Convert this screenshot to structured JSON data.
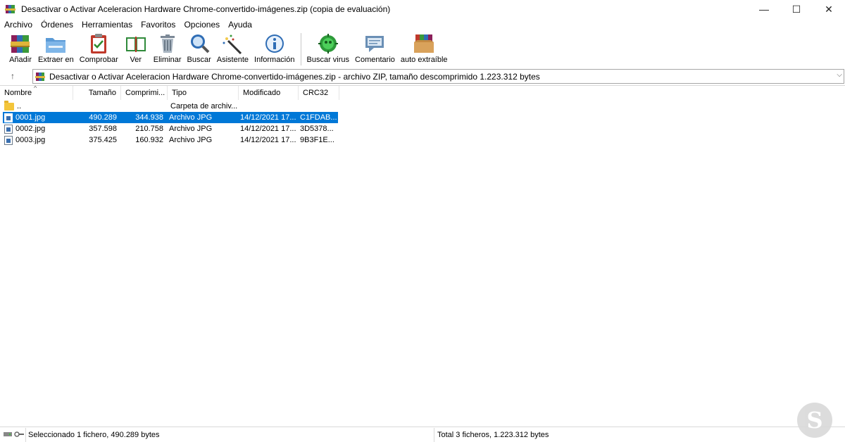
{
  "window": {
    "title": "Desactivar o Activar Aceleracion Hardware Chrome-convertido-imágenes.zip (copia de evaluación)",
    "minimize": "—",
    "maximize": "☐",
    "close": "✕"
  },
  "menu": [
    "Archivo",
    "Órdenes",
    "Herramientas",
    "Favoritos",
    "Opciones",
    "Ayuda"
  ],
  "toolbar": [
    {
      "label": "Añadir",
      "icon": "add-books-icon"
    },
    {
      "label": "Extraer en",
      "icon": "extract-folder-icon"
    },
    {
      "label": "Comprobar",
      "icon": "test-clipboard-icon"
    },
    {
      "label": "Ver",
      "icon": "view-book-icon"
    },
    {
      "label": "Eliminar",
      "icon": "trash-icon"
    },
    {
      "label": "Buscar",
      "icon": "magnifier-icon"
    },
    {
      "label": "Asistente",
      "icon": "wizard-wand-icon"
    },
    {
      "label": "Información",
      "icon": "info-icon"
    },
    {
      "label": "Buscar virus",
      "icon": "virus-scan-icon"
    },
    {
      "label": "Comentario",
      "icon": "comment-icon"
    },
    {
      "label": "auto extraíble",
      "icon": "sfx-box-icon"
    }
  ],
  "address": {
    "up": "↑",
    "path": "Desactivar o Activar Aceleracion Hardware Chrome-convertido-imágenes.zip - archivo ZIP, tamaño descomprimido 1.223.312 bytes",
    "dropdown": "⌵"
  },
  "columns": [
    "Nombre",
    "Tamaño",
    "Comprimi...",
    "Tipo",
    "Modificado",
    "CRC32"
  ],
  "sort_indicator": "^",
  "rows": [
    {
      "name": "..",
      "size": "",
      "packed": "",
      "type": "Carpeta de archiv...",
      "modified": "",
      "crc": "",
      "kind": "folder",
      "selected": false
    },
    {
      "name": "0001.jpg",
      "size": "490.289",
      "packed": "344.938",
      "type": "Archivo JPG",
      "modified": "14/12/2021 17...",
      "crc": "C1FDAB...",
      "kind": "file",
      "selected": true
    },
    {
      "name": "0002.jpg",
      "size": "357.598",
      "packed": "210.758",
      "type": "Archivo JPG",
      "modified": "14/12/2021 17...",
      "crc": "3D5378...",
      "kind": "file",
      "selected": false
    },
    {
      "name": "0003.jpg",
      "size": "375.425",
      "packed": "160.932",
      "type": "Archivo JPG",
      "modified": "14/12/2021 17...",
      "crc": "9B3F1E...",
      "kind": "file",
      "selected": false
    }
  ],
  "status": {
    "left": "Seleccionado 1 fichero, 490.289 bytes",
    "right": "Total 3 ficheros, 1.223.312 bytes"
  },
  "watermark": {
    "letter": "S"
  },
  "colors": {
    "selection": "#0078d7",
    "accent_red": "#b23a3a"
  }
}
